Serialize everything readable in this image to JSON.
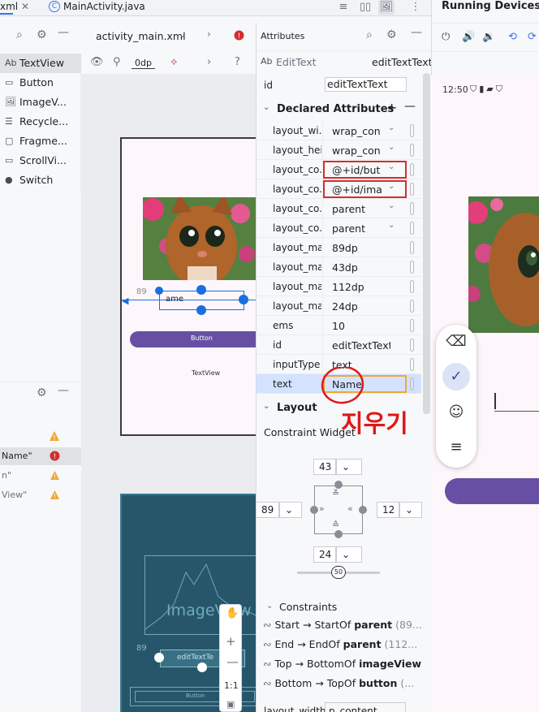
{
  "tabs": {
    "xml_fragment": "xml",
    "close": "✕",
    "java_tab": "MainActivity.java",
    "java_letter": "C"
  },
  "running_devices": {
    "title": "Running Devices",
    "status_time": "12:50"
  },
  "palette": {
    "items": [
      {
        "icon": "Ab",
        "label": "TextView",
        "selected": true
      },
      {
        "icon": "▭",
        "label": "Button",
        "selected": false
      },
      {
        "icon": "🖼",
        "label": "ImageV...",
        "selected": false
      },
      {
        "icon": "☰",
        "label": "Recycle...",
        "selected": false
      },
      {
        "icon": "▢",
        "label": "Fragme...",
        "selected": false
      },
      {
        "icon": "▭",
        "label": "ScrollVi...",
        "selected": false
      },
      {
        "icon": "●",
        "label": "Switch",
        "selected": false
      }
    ]
  },
  "tree": {
    "rows": [
      {
        "label": "Name\"",
        "level": "error"
      },
      {
        "label": "n\"",
        "level": "warning"
      },
      {
        "label": "View\"",
        "level": "warning"
      }
    ]
  },
  "design_toolbar": {
    "file": "activity_main.xml",
    "margin": "0dp",
    "help": "?"
  },
  "blueprint": {
    "margin_label": "89",
    "edit_text": "ame",
    "button_text": "Button",
    "textview_text": "TextView",
    "imageview_text": "ImageView",
    "edit2_text": "editTextTe",
    "button2_text": "Button",
    "zoom_ratio": "1:1"
  },
  "attributes": {
    "title": "Attributes",
    "component_type": "EditText",
    "component_id": "editTextText",
    "id_label": "id",
    "id_value": "editTextText",
    "declared_title": "Declared Attributes",
    "rows": [
      {
        "name": "layout_wi...",
        "value": "wrap_con",
        "dropdown": true,
        "highlight": false
      },
      {
        "name": "layout_hei...",
        "value": "wrap_con",
        "dropdown": true,
        "highlight": false
      },
      {
        "name": "layout_co...",
        "value": "@+id/but",
        "dropdown": true,
        "highlight": true
      },
      {
        "name": "layout_co...",
        "value": "@+id/ima",
        "dropdown": true,
        "highlight": true
      },
      {
        "name": "layout_co...",
        "value": "parent",
        "dropdown": true,
        "highlight": false
      },
      {
        "name": "layout_co...",
        "value": "parent",
        "dropdown": true,
        "highlight": false
      },
      {
        "name": "layout_ma...",
        "value": "89dp",
        "dropdown": false,
        "highlight": false
      },
      {
        "name": "layout_marg",
        "value": "43dp",
        "dropdown": false,
        "highlight": false
      },
      {
        "name": "layout_ma...",
        "value": "112dp",
        "dropdown": false,
        "highlight": false
      },
      {
        "name": "layout_ma...",
        "value": "24dp",
        "dropdown": false,
        "highlight": false
      },
      {
        "name": "ems",
        "value": "10",
        "dropdown": false,
        "highlight": false
      },
      {
        "name": "id",
        "value": "editTextText",
        "dropdown": false,
        "highlight": false
      },
      {
        "name": "inputType",
        "value": "text",
        "dropdown": false,
        "highlight": false
      },
      {
        "name": "text",
        "value": "Name",
        "dropdown": false,
        "highlight": false
      }
    ],
    "layout_title": "Layout",
    "constraint_widget": "Constraint Widget",
    "widget": {
      "top": "43",
      "left": "89",
      "right": "12",
      "bottom": "24",
      "bias": "50"
    },
    "constraints_title": "Constraints",
    "constraints": [
      {
        "side": "Start",
        "arrow": "→",
        "target": "StartOf",
        "bold": "parent",
        "extra": "(89..."
      },
      {
        "side": "End",
        "arrow": "→",
        "target": "EndOf",
        "bold": "parent",
        "extra": "(112..."
      },
      {
        "side": "Top",
        "arrow": "→",
        "target": "BottomOf",
        "bold": "imageView",
        "extra": ""
      },
      {
        "side": "Bottom",
        "arrow": "→",
        "target": "TopOf",
        "bold": "button",
        "extra": "(..."
      }
    ],
    "last_row_name": "layout_width",
    "last_row_value": "p_content"
  },
  "annotation": {
    "handwritten": "지우기"
  },
  "colors": {
    "accent": "#3574f0",
    "error": "#d32f2f",
    "warning": "#f0a732",
    "primary_purple": "#6750a4"
  }
}
